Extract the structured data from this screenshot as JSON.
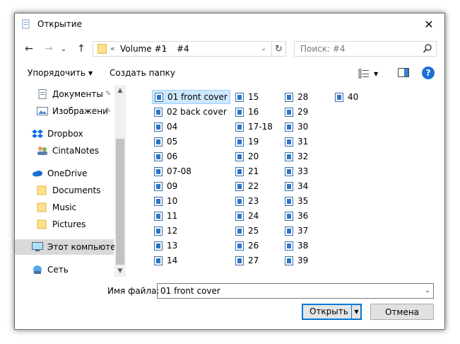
{
  "window": {
    "title": "Открытие",
    "close_glyph": "✕"
  },
  "navigation": {
    "back_glyph": "←",
    "forward_glyph": "→",
    "recent_glyph": "⌄",
    "up_glyph": "↑",
    "address": {
      "overflow_glyph": "«",
      "crumbs": [
        "Volume #1",
        "#4"
      ],
      "separator": "›",
      "dropdown_glyph": "⌄",
      "refresh_glyph": "↻"
    },
    "search": {
      "placeholder": "Поиск: #4"
    }
  },
  "toolbar": {
    "organize_label": "Упорядочить",
    "organize_caret": "▼",
    "new_folder_label": "Создать папку",
    "view_caret": "▼",
    "help_glyph": "?"
  },
  "sidebar": {
    "items": [
      {
        "label": "Документы",
        "icon": "documents-icon",
        "pinned": true
      },
      {
        "label": "Изображени",
        "icon": "pictures-icon",
        "pinned": true
      },
      {
        "label": "Dropbox",
        "icon": "dropbox-icon"
      },
      {
        "label": "CintaNotes",
        "icon": "cintanotes-icon"
      },
      {
        "label": "OneDrive",
        "icon": "onedrive-icon"
      },
      {
        "label": "Documents",
        "icon": "folder-icon"
      },
      {
        "label": "Music",
        "icon": "folder-icon"
      },
      {
        "label": "Pictures",
        "icon": "folder-icon"
      },
      {
        "label": "Этот компьютер",
        "icon": "computer-icon",
        "selected": true
      },
      {
        "label": "Сеть",
        "icon": "network-icon"
      }
    ],
    "pin_glyph": "📌",
    "scroll_up_glyph": "▲",
    "scroll_down_glyph": "▼"
  },
  "files": {
    "columns": [
      [
        "01 front cover",
        "02 back cover",
        "04",
        "05",
        "06",
        "07-08",
        "09",
        "10",
        "11",
        "12",
        "13",
        "14"
      ],
      [
        "15",
        "16",
        "17-18",
        "19",
        "20",
        "21",
        "22",
        "23",
        "24",
        "25",
        "26",
        "27"
      ],
      [
        "28",
        "29",
        "30",
        "31",
        "32",
        "33",
        "34",
        "35",
        "36",
        "37",
        "38",
        "39"
      ],
      [
        "40"
      ]
    ],
    "selected": "01 front cover"
  },
  "footer": {
    "filename_label": "Имя файла:",
    "filename_value": "01 front cover",
    "filename_dropdown_glyph": "⌄",
    "open_label": "Открыть",
    "open_split_glyph": "▼",
    "cancel_label": "Отмена"
  },
  "colors": {
    "accent": "#0078d7",
    "selection": "#cce8ff",
    "help": "#1c6fd6",
    "folder": "#ffe08c"
  }
}
